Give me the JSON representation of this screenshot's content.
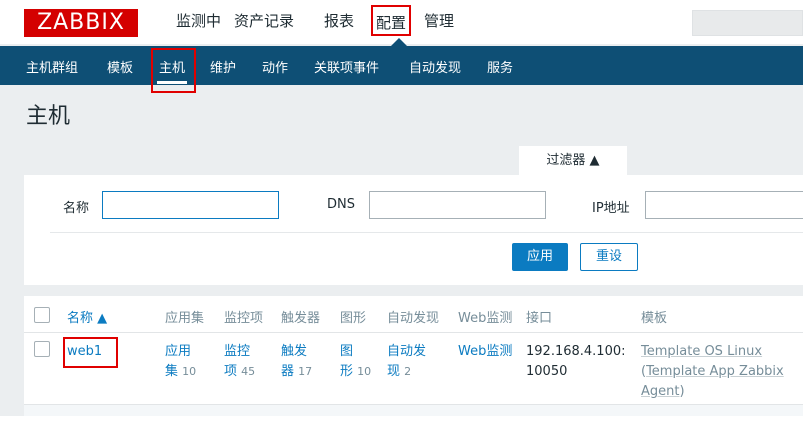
{
  "logo": "ZABBIX",
  "top_menu": [
    {
      "label": "监测中"
    },
    {
      "label": "资产记录"
    },
    {
      "label": "报表"
    },
    {
      "label": "配置"
    },
    {
      "label": "管理"
    }
  ],
  "sub_menu": [
    {
      "label": "主机群组"
    },
    {
      "label": "模板"
    },
    {
      "label": "主机"
    },
    {
      "label": "维护"
    },
    {
      "label": "动作"
    },
    {
      "label": "关联项事件"
    },
    {
      "label": "自动发现"
    },
    {
      "label": "服务"
    }
  ],
  "page_title": "主机",
  "filter": {
    "tab_label": "过滤器 ▲",
    "name_label": "名称",
    "name_value": "",
    "dns_label": "DNS",
    "dns_value": "",
    "ip_label": "IP地址",
    "ip_value": "",
    "apply_label": "应用",
    "reset_label": "重设"
  },
  "table": {
    "headers": {
      "name": "名称 ▲",
      "apps": "应用集",
      "items": "监控项",
      "triggers": "触发器",
      "graphs": "图形",
      "discovery": "自动发现",
      "web": "Web监测",
      "interface": "接口",
      "templates": "模板"
    },
    "rows": [
      {
        "name": "web1",
        "apps_line1": "应用",
        "apps_line2": "集",
        "apps_count": "10",
        "items_line1": "监控",
        "items_line2": "项",
        "items_count": "45",
        "triggers_line1": "触发",
        "triggers_line2": "器",
        "triggers_count": "17",
        "graphs_line1": "图",
        "graphs_line2": "形",
        "graphs_count": "10",
        "discovery_line1": "自动发",
        "discovery_line2": "现",
        "discovery_count": "2",
        "web": "Web监测",
        "interface_line1": "192.168.4.100:",
        "interface_line2": "10050",
        "template_main": "Template OS Linux",
        "template_open": "(",
        "template_sub_line1": "Template App Zabbix",
        "template_sub_line2": "Agent",
        "template_close": ")"
      }
    ]
  },
  "colors": {
    "logo_red": "#d40000",
    "nav_blue": "#0e4f75",
    "link_blue": "#0b7bc1",
    "highlight_red": "#e00000"
  }
}
